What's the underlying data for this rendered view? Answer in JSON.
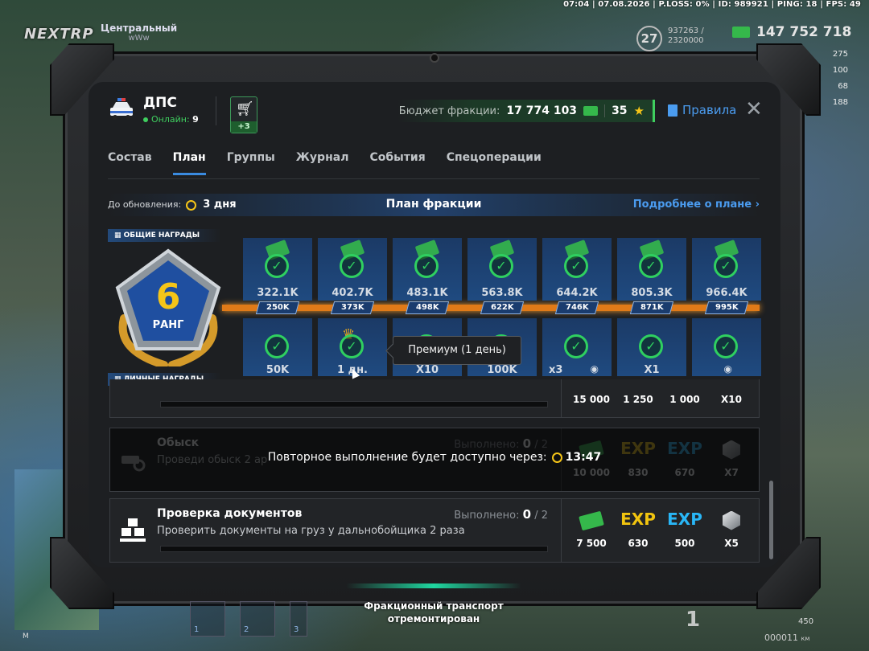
{
  "hud": {
    "top_info": "07:04 | 07.08.2026 | P.LOSS: 0% | ID: 989921 | PING: 18 | FPS: 49",
    "logo": "NEXTRP",
    "server_name": "Центральный",
    "server_sub": "wWw",
    "level": "27",
    "xp_line1": "937263 /",
    "xp_line2": "2320000",
    "money": "147 752 718",
    "side_stats": [
      "275",
      "100",
      "68",
      "188"
    ],
    "notification_line1": "Фракционный транспорт",
    "notification_line2": "отремонтирован",
    "speed": "1",
    "odometer": "000011",
    "odometer_unit": "км",
    "fuel": "450",
    "map_key": "M",
    "hotbar_slots": [
      "1",
      "2",
      "3"
    ]
  },
  "header": {
    "faction_name": "ДПС",
    "online_label": "Онлайн:",
    "online_count": "9",
    "cart_badge": "+3",
    "budget_label": "Бюджет фракции:",
    "budget_value": "17 774 103",
    "stars_value": "35",
    "rules_label": "Правила"
  },
  "tabs": [
    {
      "label": "Состав",
      "active": false
    },
    {
      "label": "План",
      "active": true
    },
    {
      "label": "Группы",
      "active": false
    },
    {
      "label": "Журнал",
      "active": false
    },
    {
      "label": "События",
      "active": false
    },
    {
      "label": "Спецоперации",
      "active": false
    }
  ],
  "plan": {
    "update_label": "До обновления:",
    "update_value": "3 дня",
    "title": "План фракции",
    "more_link": "Подробнее о плане",
    "common_label": "ОБЩИЕ НАГРАДЫ",
    "personal_label": "ЛИЧНЫЕ НАГРАДЫ",
    "rank_number": "6",
    "rank_label": "РАНГ",
    "milestones": [
      "250K",
      "373K",
      "498K",
      "622K",
      "746K",
      "871K",
      "995K"
    ],
    "common_rewards": [
      "322.1K",
      "402.7K",
      "483.1K",
      "563.8K",
      "644.2K",
      "805.3K",
      "966.4K"
    ],
    "personal_rewards": [
      "50K",
      "1 дн.",
      "X10",
      "100K",
      "x3",
      "X1",
      ""
    ],
    "tooltip": "Премиум (1 день)"
  },
  "tasks": [
    {
      "title": "",
      "desc": "",
      "rewards": [
        "15 000",
        "1 250",
        "1 000",
        "X10"
      ]
    },
    {
      "title": "Обыск",
      "desc": "Проведи обыск 2 ар",
      "done_label": "Выполнено:",
      "done_value": "0",
      "done_total": "2",
      "cooldown_label": "Повторное выполнение будет доступно через:",
      "cooldown_value": "13:47",
      "rewards": [
        "10 000",
        "830",
        "670",
        "X7"
      ]
    },
    {
      "title": "Проверка документов",
      "desc": "Проверить документы на груз у дальнобойщика 2 раза",
      "done_label": "Выполнено:",
      "done_value": "0",
      "done_total": "2",
      "rewards": [
        "7 500",
        "630",
        "500",
        "X5"
      ]
    }
  ],
  "exp_label": "EXP",
  "colors": {
    "accent_blue": "#3a8be0",
    "check_green": "#2fd060",
    "progress_orange": "#e07a18",
    "star_gold": "#f5c518"
  }
}
